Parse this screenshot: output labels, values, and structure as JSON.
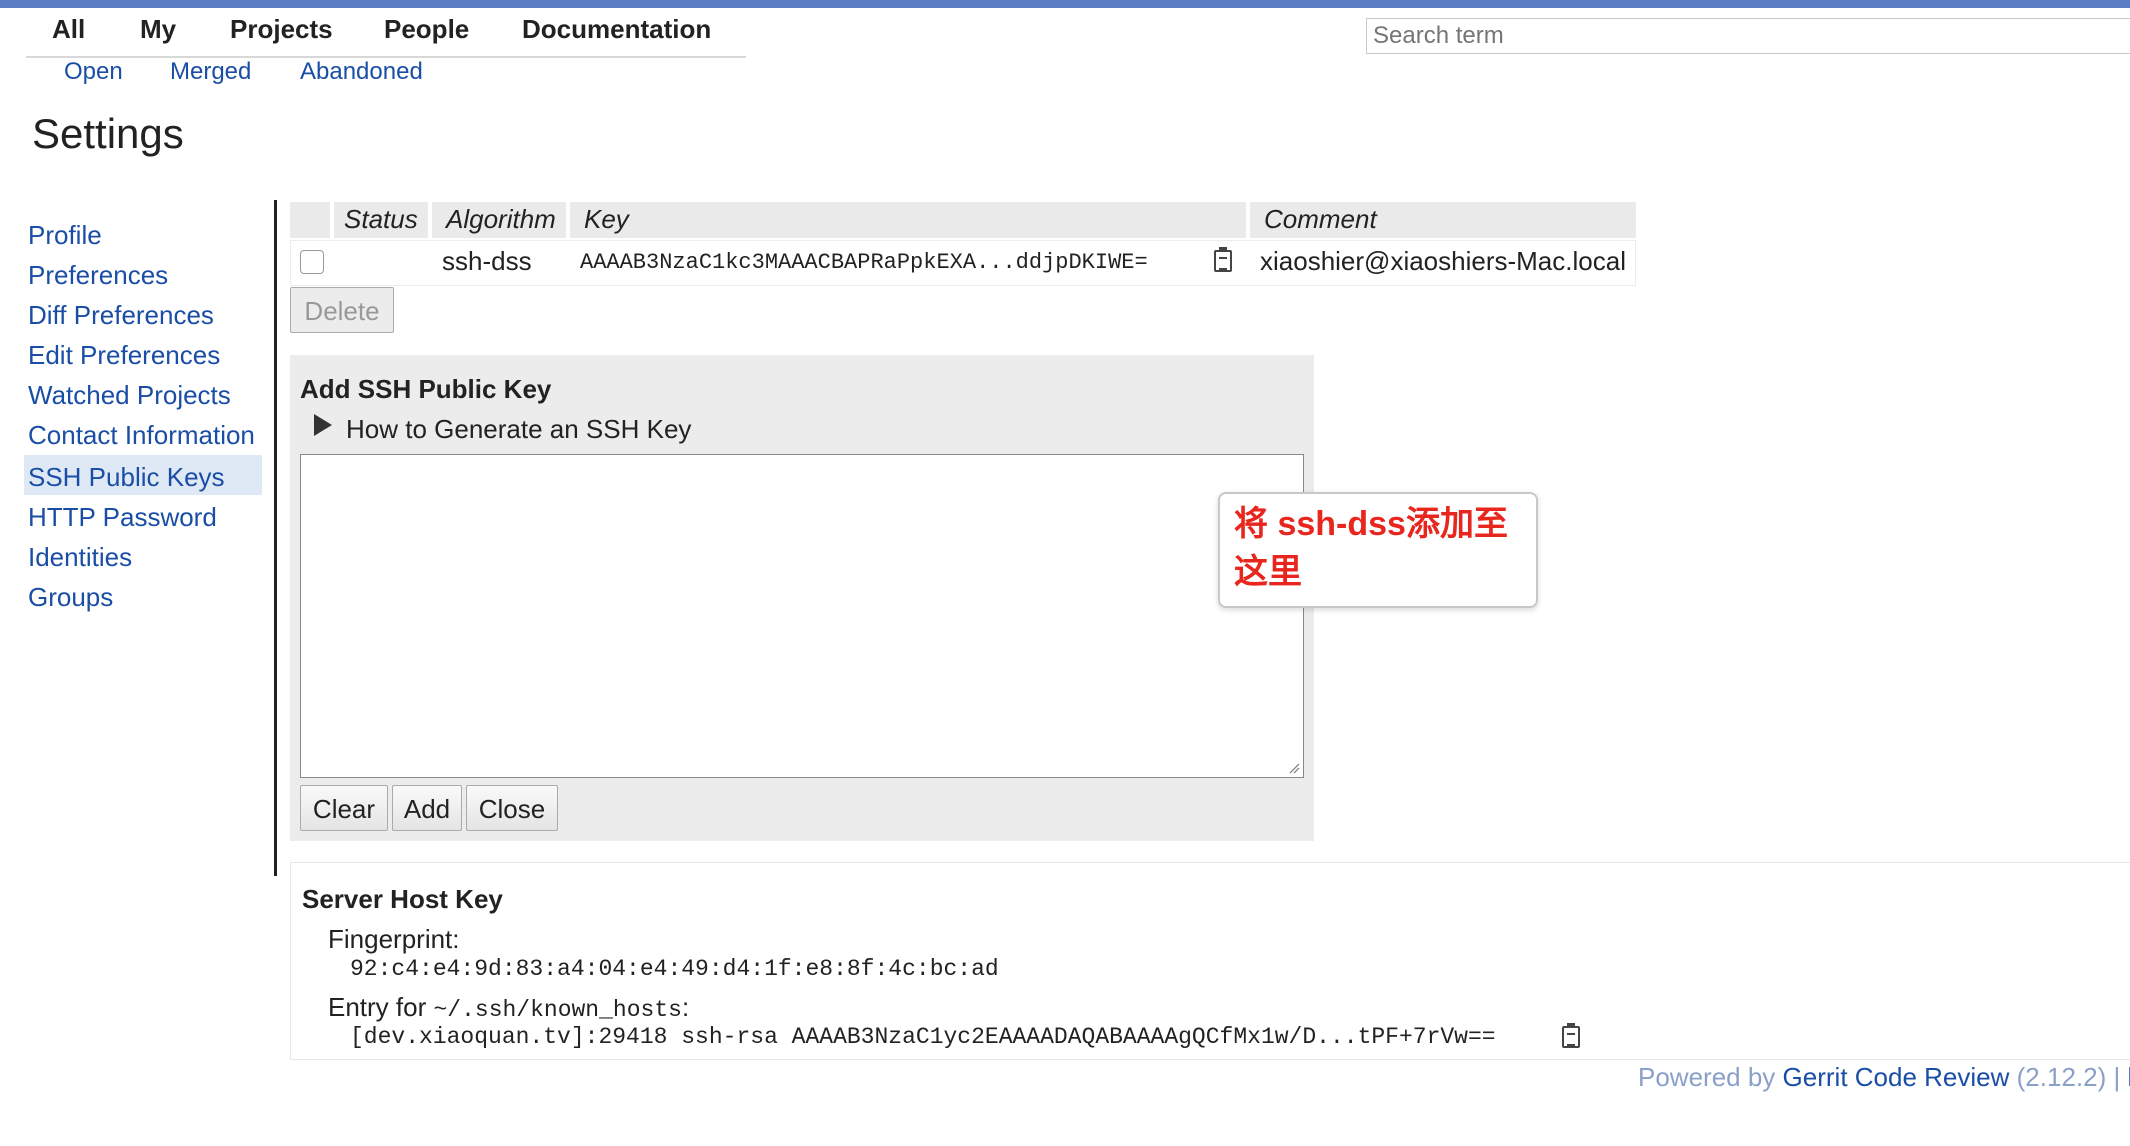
{
  "menu": {
    "top": [
      "All",
      "My",
      "Projects",
      "People",
      "Documentation"
    ],
    "sub": [
      "Open",
      "Merged",
      "Abandoned"
    ]
  },
  "search": {
    "placeholder": "Search term"
  },
  "page": {
    "title": "Settings"
  },
  "nav": {
    "items": [
      "Profile",
      "Preferences",
      "Diff Preferences",
      "Edit Preferences",
      "Watched Projects",
      "Contact Information",
      "SSH Public Keys",
      "HTTP Password",
      "Identities",
      "Groups"
    ],
    "selected": "SSH Public Keys"
  },
  "keys_table": {
    "headers": {
      "status": "Status",
      "algorithm": "Algorithm",
      "key": "Key",
      "comment": "Comment"
    },
    "rows": [
      {
        "status": "",
        "algorithm": "ssh-dss",
        "key": "AAAAB3NzaC1kc3MAAACBAPRaPpkEXA...ddjpDKIWE=",
        "comment": "xiaoshier@xiaoshiers-Mac.local"
      }
    ],
    "delete_label": "Delete"
  },
  "add_key": {
    "title": "Add SSH Public Key",
    "howto": "How to Generate an SSH Key",
    "textarea_value": "",
    "buttons": {
      "clear": "Clear",
      "add": "Add",
      "close": "Close"
    }
  },
  "annotation": {
    "line1": "将 ssh-dss添加至",
    "line2": "这里",
    "color": "#e8261d"
  },
  "server_host_key": {
    "title": "Server Host Key",
    "fingerprint_label": "Fingerprint:",
    "fingerprint": "92:c4:e4:9d:83:a4:04:e4:49:d4:1f:e8:8f:4c:bc:ad",
    "entry_label": "Entry for",
    "entry_path": "~/.ssh/known_hosts",
    "entry_colon": ":",
    "entry": "[dev.xiaoquan.tv]:29418 ssh-rsa AAAAB3NzaC1yc2EAAAADAQABAAAAgQCfMx1w/D...tPF+7rVw=="
  },
  "footer": {
    "prefix": "Powered by",
    "link": "Gerrit Code Review",
    "version": "(2.12.2) | ",
    "cut": "l"
  },
  "colors": {
    "accent_bar": "#5b7cc2",
    "link": "#1a4ea6",
    "nav_selected_bg": "#dfe9f5"
  },
  "icons": {
    "copy": "clipboard-icon",
    "expand": "triangle-right-icon"
  }
}
